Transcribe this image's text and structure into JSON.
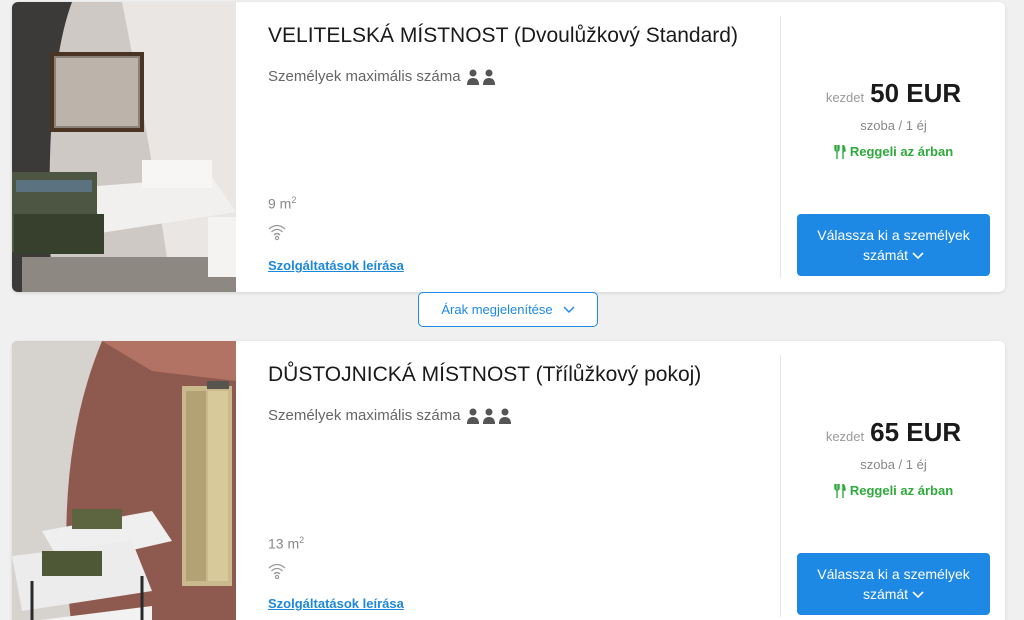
{
  "rooms": [
    {
      "title": "VELITELSKÁ MÍSTNOST (Dvoulůžkový Standard)",
      "capacity_label": "Személyek maximális száma",
      "persons": 2,
      "area": "9 m",
      "area_sup": "2",
      "services_link": "Szolgáltatások leírása",
      "price_from": "kezdet",
      "price": "50 EUR",
      "price_per": "szoba / 1 éj",
      "breakfast": "Reggeli az árban",
      "select_button": "Válassza ki a személyek számát"
    },
    {
      "title": "DŮSTOJNICKÁ MÍSTNOST (Třílůžkový pokoj)",
      "capacity_label": "Személyek maximális száma",
      "persons": 3,
      "area": "13 m",
      "area_sup": "2",
      "services_link": "Szolgáltatások leírása",
      "price_from": "kezdet",
      "price": "65 EUR",
      "price_per": "szoba / 1 éj",
      "breakfast": "Reggeli az árban",
      "select_button": "Válassza ki a személyek számát"
    }
  ],
  "show_prices_button": "Árak megjelenítése",
  "colors": {
    "accent": "#1e88e5",
    "breakfast": "#2eaa3c"
  },
  "icons": [
    "person-icon",
    "wifi-icon",
    "fork-knife-icon",
    "chevron-down-icon"
  ]
}
